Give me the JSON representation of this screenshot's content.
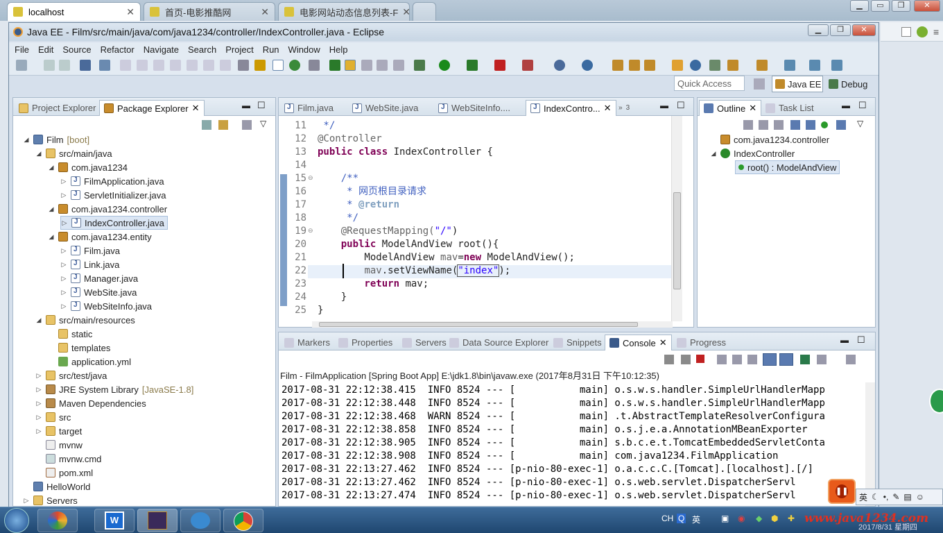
{
  "browser": {
    "tabs": [
      {
        "title": "localhost"
      },
      {
        "title": "首页-电影推酷网"
      },
      {
        "title": "电影网站动态信息列表-F"
      }
    ]
  },
  "eclipse": {
    "title": "Java EE - Film/src/main/java/com/java1234/controller/IndexController.java - Eclipse",
    "menu": [
      "File",
      "Edit",
      "Source",
      "Refactor",
      "Navigate",
      "Search",
      "Project",
      "Run",
      "Window",
      "Help"
    ],
    "quick_access": "Quick Access",
    "perspectives": {
      "javaee": "Java EE",
      "debug": "Debug"
    },
    "left_tabs": {
      "project_explorer": "Project Explorer",
      "package_explorer": "Package Explorer"
    },
    "tree": [
      {
        "label": "Film",
        "decor": "[boot]"
      },
      {
        "label": "src/main/java"
      },
      {
        "label": "com.java1234"
      },
      {
        "label": "FilmApplication.java"
      },
      {
        "label": "ServletInitializer.java"
      },
      {
        "label": "com.java1234.controller"
      },
      {
        "label": "IndexController.java"
      },
      {
        "label": "com.java1234.entity"
      },
      {
        "label": "Film.java"
      },
      {
        "label": "Link.java"
      },
      {
        "label": "Manager.java"
      },
      {
        "label": "WebSite.java"
      },
      {
        "label": "WebSiteInfo.java"
      },
      {
        "label": "src/main/resources"
      },
      {
        "label": "static"
      },
      {
        "label": "templates"
      },
      {
        "label": "application.yml"
      },
      {
        "label": "src/test/java"
      },
      {
        "label": "JRE System Library",
        "decor": "[JavaSE-1.8]"
      },
      {
        "label": "Maven Dependencies"
      },
      {
        "label": "src"
      },
      {
        "label": "target"
      },
      {
        "label": "mvnw"
      },
      {
        "label": "mvnw.cmd"
      },
      {
        "label": "pom.xml"
      },
      {
        "label": "HelloWorld"
      },
      {
        "label": "Servers"
      }
    ],
    "editor_tabs": [
      "Film.java",
      "WebSite.java",
      "WebSiteInfo....",
      "IndexContro...",
      "3"
    ],
    "line_numbers": [
      "11",
      "12",
      "13",
      "14",
      "15",
      "16",
      "17",
      "18",
      "19",
      "20",
      "21",
      "22",
      "23",
      "24",
      "25"
    ],
    "code": {
      "l11": " */",
      "l12": "@Controller",
      "l13a": "public class",
      "l13b": " IndexController {",
      "l15": "    /**",
      "l16": "     * 网页根目录请求",
      "l17a": "     * ",
      "l17b": "@return",
      "l18": "     */",
      "l19a": "    @RequestMapping(",
      "l19b": "\"/\"",
      "l19c": ")",
      "l20a": "    public",
      "l20b": " ModelAndView root(){",
      "l21a": "        ModelAndView ",
      "l21b": "mav",
      "l21c": "=",
      "l21d": "new",
      "l21e": " ModelAndView();",
      "l22a": "        ",
      "l22b": "mav",
      "l22c": ".setViewName(",
      "l22d": "\"index\"",
      "l22e": ");",
      "l23a": "        return",
      "l23b": " mav;",
      "l24": "    }",
      "l25": "}"
    },
    "outline_tabs": {
      "outline": "Outline",
      "tasklist": "Task List"
    },
    "outline": [
      {
        "label": "com.java1234.controller"
      },
      {
        "label": "IndexController"
      },
      {
        "label": "root() : ModelAndView"
      }
    ],
    "bottom_tabs": [
      "Markers",
      "Properties",
      "Servers",
      "Data Source Explorer",
      "Snippets",
      "Console",
      "Progress"
    ],
    "console_header": "Film - FilmApplication [Spring Boot App] E:\\jdk1.8\\bin\\javaw.exe (2017年8月31日 下午10:12:35)",
    "console_lines": [
      "2017-08-31 22:12:38.415  INFO 8524 --- [           main] o.s.w.s.handler.SimpleUrlHandlerMapp",
      "2017-08-31 22:12:38.448  INFO 8524 --- [           main] o.s.w.s.handler.SimpleUrlHandlerMapp",
      "2017-08-31 22:12:38.468  WARN 8524 --- [           main] .t.AbstractTemplateResolverConfigura",
      "2017-08-31 22:12:38.858  INFO 8524 --- [           main] o.s.j.e.a.AnnotationMBeanExporter",
      "2017-08-31 22:12:38.905  INFO 8524 --- [           main] s.b.c.e.t.TomcatEmbeddedServletConta",
      "2017-08-31 22:12:38.908  INFO 8524 --- [           main] com.java1234.FilmApplication",
      "2017-08-31 22:13:27.462  INFO 8524 --- [p-nio-80-exec-1] o.a.c.c.C.[Tomcat].[localhost].[/]",
      "2017-08-31 22:13:27.462  INFO 8524 --- [p-nio-80-exec-1] o.s.web.servlet.DispatcherServl",
      "2017-08-31 22:13:27.474  INFO 8524 --- [p-nio-80-exec-1] o.s.web.servlet.DispatcherServl"
    ]
  },
  "taskbar": {
    "lang": "CH",
    "ime": "英",
    "watermark": "www.java1234.com",
    "clock": "2017/8/31 星期四"
  },
  "colors": {
    "accent": "#3b6ea5",
    "selection": "#dbe6f4"
  }
}
